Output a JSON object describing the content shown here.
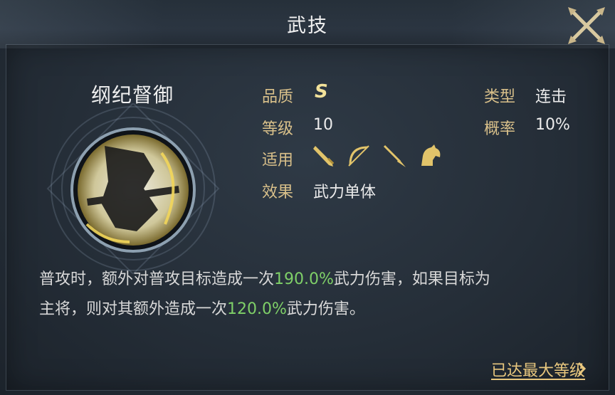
{
  "header": {
    "title": "武技"
  },
  "skill": {
    "name": "纲纪督御",
    "quality_label": "品质",
    "quality_value": "S",
    "level_label": "等级",
    "level_value": "10",
    "applicable_label": "适用",
    "applicable_icons": [
      "sword-icon",
      "bow-icon",
      "spear-icon",
      "horse-icon"
    ],
    "effect_label": "效果",
    "effect_value": "武力单体",
    "type_label": "类型",
    "type_value": "连击",
    "chance_label": "概率",
    "chance_value": "10%"
  },
  "description": {
    "part1": "普攻时，额外对普攻目标造成一次",
    "value1": "190.0%",
    "part2": "武力伤害，如果目标为",
    "part3": "主将，则对其额外造成一次",
    "value2": "120.0%",
    "part4": "武力伤害。"
  },
  "footer": {
    "max_level_label": "已达最大等级"
  },
  "colors": {
    "label": "#d9c08a",
    "highlight": "#7fd068",
    "link": "#e8c77e",
    "grade": "#f3e29a"
  }
}
